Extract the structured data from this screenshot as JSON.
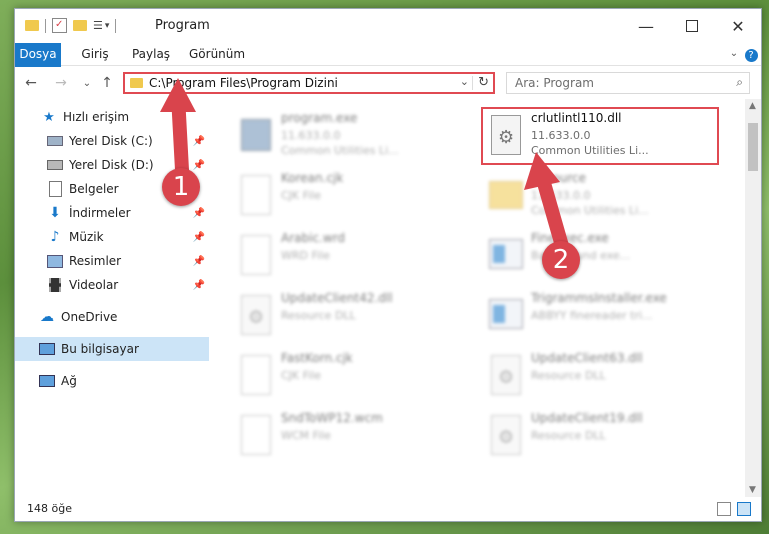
{
  "window": {
    "title": "Program"
  },
  "ribbon": {
    "tabs": [
      "Dosya",
      "Giriş",
      "Paylaş",
      "Görünüm"
    ]
  },
  "nav": {
    "address": "C:\\Program Files\\Program Dizini",
    "search_placeholder": "Ara: Program"
  },
  "sidebar": {
    "items": [
      {
        "label": "Hızlı erişim",
        "icon": "star-icon"
      },
      {
        "label": "Yerel Disk (C:)",
        "icon": "drive-icon"
      },
      {
        "label": "Yerel Disk (D:)",
        "icon": "drive-icon"
      },
      {
        "label": "Belgeler",
        "icon": "documents-icon"
      },
      {
        "label": "İndirmeler",
        "icon": "download-icon"
      },
      {
        "label": "Müzik",
        "icon": "music-icon"
      },
      {
        "label": "Resimler",
        "icon": "pictures-icon"
      },
      {
        "label": "Videolar",
        "icon": "videos-icon"
      },
      {
        "label": "OneDrive",
        "icon": "cloud-icon"
      },
      {
        "label": "Bu bilgisayar",
        "icon": "computer-icon"
      },
      {
        "label": "Ağ",
        "icon": "network-icon"
      }
    ]
  },
  "files": [
    {
      "name": "program.exe",
      "meta1": "11.633.0.0",
      "meta2": "Common Utilities Li..."
    },
    {
      "name": "crlutlintl110.dll",
      "meta1": "11.633.0.0",
      "meta2": "Common Utilities Li..."
    },
    {
      "name": "Korean.cjk",
      "meta1": "CJK File",
      "meta2": ""
    },
    {
      "name": "Resource",
      "meta1": "11.633.0.0",
      "meta2": "Common Utilities Li..."
    },
    {
      "name": "Arabic.wrd",
      "meta1": "WRD File",
      "meta2": ""
    },
    {
      "name": "FineExec.exe",
      "meta1": "Background exe...",
      "meta2": ""
    },
    {
      "name": "UpdateClient42.dll",
      "meta1": "Resource DLL",
      "meta2": ""
    },
    {
      "name": "TrigrammsInstaller.exe",
      "meta1": "ABBYY finereader tri...",
      "meta2": ""
    },
    {
      "name": "FastKorn.cjk",
      "meta1": "CJK File",
      "meta2": ""
    },
    {
      "name": "UpdateClient63.dll",
      "meta1": "Resource DLL",
      "meta2": ""
    },
    {
      "name": "SndToWP12.wcm",
      "meta1": "WCM File",
      "meta2": ""
    },
    {
      "name": "UpdateClient19.dll",
      "meta1": "Resource DLL",
      "meta2": ""
    }
  ],
  "status": {
    "item_count": "148 öğe"
  },
  "annotations": {
    "badge1": "1",
    "badge2": "2"
  },
  "colors": {
    "accent": "#1979ca",
    "highlight": "#e04a52",
    "badge": "#d9444c"
  }
}
